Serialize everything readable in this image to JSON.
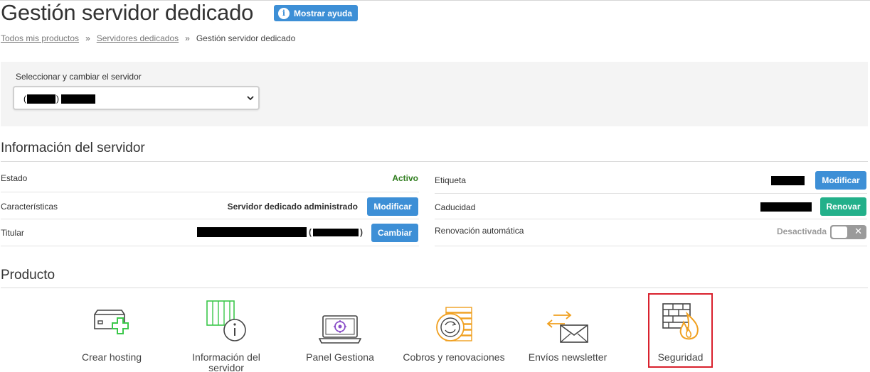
{
  "page": {
    "title": "Gestión servidor dedicado",
    "help_button": "Mostrar ayuda"
  },
  "breadcrumb": {
    "items": [
      "Todos mis productos",
      "Servidores dedicados",
      "Gestión servidor dedicado"
    ],
    "separator": "»"
  },
  "server_selector": {
    "label": "Seleccionar y cambiar el servidor",
    "selected_prefix": "(",
    "selected_suffix": ")"
  },
  "server_info": {
    "title": "Información del servidor",
    "estado": {
      "label": "Estado",
      "value": "Activo"
    },
    "caracteristicas": {
      "label": "Características",
      "value": "Servidor dedicado administrado",
      "button": "Modificar"
    },
    "titular": {
      "label": "Titular",
      "open_paren": "(",
      "close_paren": ")",
      "button": "Cambiar"
    },
    "etiqueta": {
      "label": "Etiqueta",
      "button": "Modificar"
    },
    "caducidad": {
      "label": "Caducidad",
      "button": "Renovar"
    },
    "renovacion": {
      "label": "Renovación automática",
      "status": "Desactivada",
      "toggle_mark": "✕"
    }
  },
  "producto": {
    "title": "Producto",
    "items": [
      {
        "label": "Crear hosting",
        "icon": "server-plus-icon"
      },
      {
        "label": "Información del servidor",
        "icon": "server-info-icon"
      },
      {
        "label": "Panel Gestiona",
        "icon": "laptop-panel-icon"
      },
      {
        "label": "Cobros y renovaciones",
        "icon": "coins-renew-icon"
      },
      {
        "label": "Envíos newsletter",
        "icon": "newsletter-envelope-icon"
      },
      {
        "label": "Seguridad",
        "icon": "firewall-icon"
      }
    ]
  },
  "colors": {
    "accent_blue": "#3d8fd6",
    "renew_green": "#23b08a",
    "active_green": "#2f7d1e",
    "highlight_red": "#d9212d",
    "icon_green": "#3cc84b",
    "icon_orange": "#f0a020",
    "icon_purple": "#8a4fc8"
  }
}
